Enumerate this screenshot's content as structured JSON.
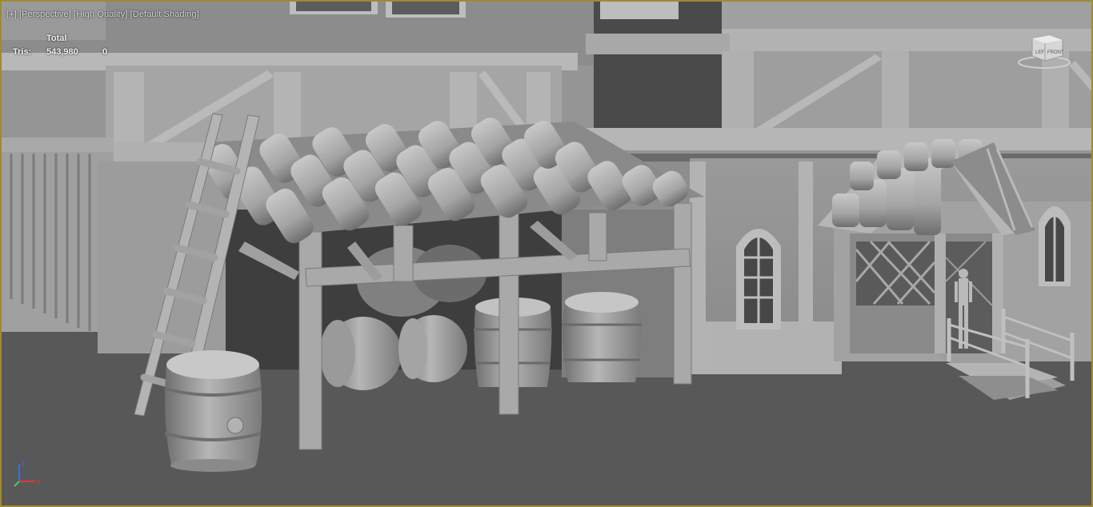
{
  "viewport": {
    "label_parts": [
      "[+]",
      "[Perspective]",
      "[High Quality]",
      "[Default Shading]"
    ],
    "stats": {
      "total_label": "Total",
      "tris_label": "Tris:",
      "tris_total": "543,980",
      "tris_selected": "0"
    },
    "viewcube": {
      "left_face": "LEF",
      "front_face": "FRONT"
    },
    "axis": {
      "x": "x",
      "z": "z"
    }
  },
  "colors": {
    "border": "#a08a2e",
    "background": "#6a6a6a",
    "ground": "#5a5a5a",
    "model": "#a3a3a3"
  }
}
